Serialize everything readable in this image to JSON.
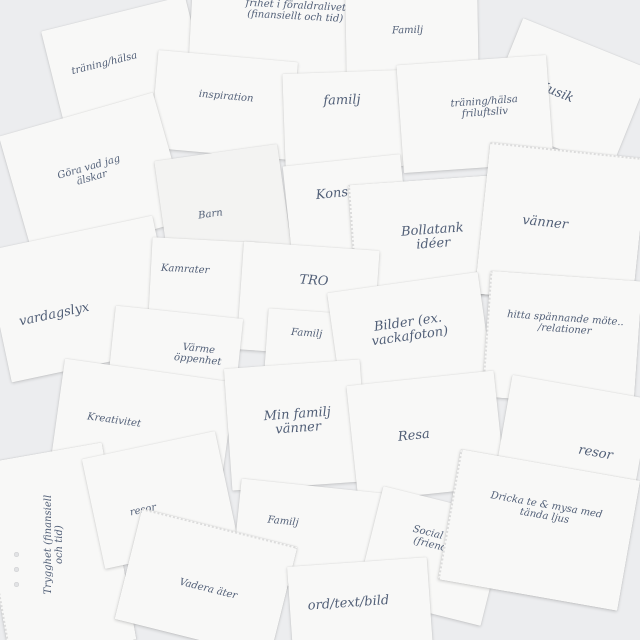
{
  "notes": [
    {
      "text": "träning/hälsa"
    },
    {
      "text": "frihet i föraldralivet (finansiellt och tid)"
    },
    {
      "text": "Familj"
    },
    {
      "text": "inspiration"
    },
    {
      "text": "familj"
    },
    {
      "text": "träning/hälsa friluftsliv"
    },
    {
      "text": "Musik"
    },
    {
      "text": "Göra vad jag älskar"
    },
    {
      "text": "Barn"
    },
    {
      "text": "Konst"
    },
    {
      "text": "Bollatank idéer"
    },
    {
      "text": "vänner"
    },
    {
      "text": "vardagslyx"
    },
    {
      "text": "Kamrater"
    },
    {
      "text": "TRO"
    },
    {
      "text": "Familj"
    },
    {
      "text": "Bilder (ex. vackafoton)"
    },
    {
      "text": "hitta spännande möte.. /relationer"
    },
    {
      "text": "Värme öppenhet"
    },
    {
      "text": "Kreativitet"
    },
    {
      "text": "Min familj vänner"
    },
    {
      "text": "Resa"
    },
    {
      "text": "resor"
    },
    {
      "text": "Trygghet (finansiell och tid)"
    },
    {
      "text": "resor"
    },
    {
      "text": "Familj"
    },
    {
      "text": "Social life (friends)"
    },
    {
      "text": "Dricka te & mysa med tända ljus"
    },
    {
      "text": "Vadera äter"
    },
    {
      "text": "ord/text/bild"
    }
  ]
}
